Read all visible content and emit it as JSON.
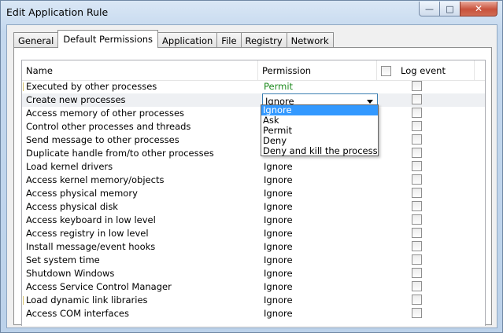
{
  "window": {
    "title": "Edit Application Rule"
  },
  "window_buttons": {
    "minimize": "—",
    "maximize": "□",
    "close": "✕"
  },
  "tabs": [
    {
      "label": "General"
    },
    {
      "label": "Default Permissions"
    },
    {
      "label": "Application"
    },
    {
      "label": "File"
    },
    {
      "label": "Registry"
    },
    {
      "label": "Network"
    }
  ],
  "active_tab": "Default Permissions",
  "columns": {
    "name": "Name",
    "permission": "Permission",
    "log_event": "Log event"
  },
  "rows": [
    {
      "name": "Executed by other processes",
      "permission": "Permit"
    },
    {
      "name": "Create new processes",
      "permission": "Ignore"
    },
    {
      "name": "Access memory of other processes",
      "permission": ""
    },
    {
      "name": "Control other processes and threads",
      "permission": ""
    },
    {
      "name": "Send message to other processes",
      "permission": ""
    },
    {
      "name": "Duplicate handle from/to other processes",
      "permission": ""
    },
    {
      "name": "Load kernel drivers",
      "permission": "Ignore"
    },
    {
      "name": "Access kernel memory/objects",
      "permission": "Ignore"
    },
    {
      "name": "Access physical memory",
      "permission": "Ignore"
    },
    {
      "name": "Access physical disk",
      "permission": "Ignore"
    },
    {
      "name": "Access keyboard in low level",
      "permission": "Ignore"
    },
    {
      "name": "Access registry in low level",
      "permission": "Ignore"
    },
    {
      "name": "Install message/event hooks",
      "permission": "Ignore"
    },
    {
      "name": "Set system time",
      "permission": "Ignore"
    },
    {
      "name": "Shutdown Windows",
      "permission": "Ignore"
    },
    {
      "name": "Access Service Control Manager",
      "permission": "Ignore"
    },
    {
      "name": "Load dynamic link libraries",
      "permission": "Ignore"
    },
    {
      "name": "Access COM interfaces",
      "permission": "Ignore"
    }
  ],
  "dropdown": {
    "selected": "Ignore",
    "options": [
      "Ignore",
      "Ask",
      "Permit",
      "Deny",
      "Deny and kill the process"
    ]
  },
  "colors": {
    "permit": "#1e8a1e",
    "highlight": "#3399ff",
    "close_button": "#c8523c"
  }
}
